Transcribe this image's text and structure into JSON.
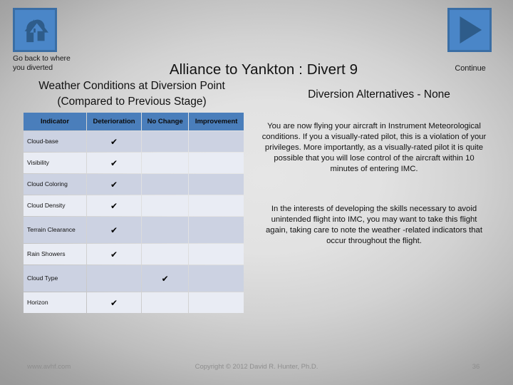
{
  "nav": {
    "back": {
      "icon": "u-turn-arrow-icon",
      "label": "Go back to where you diverted"
    },
    "continue": {
      "icon": "play-triangle-icon",
      "label": "Continue"
    }
  },
  "header": {
    "title": "Alliance to Yankton : Divert 9",
    "weather_heading": "Weather Conditions at Diversion Point",
    "weather_subheading": "(Compared to Previous Stage)",
    "alternatives_heading": "Diversion Alternatives - None"
  },
  "table": {
    "columns": [
      "Indicator",
      "Deterioration",
      "No Change",
      "Improvement"
    ],
    "check_glyph": "✔",
    "rows": [
      {
        "indicator": "Cloud-base",
        "deterioration": "✔",
        "no_change": "",
        "improvement": ""
      },
      {
        "indicator": "Visibility",
        "deterioration": "✔",
        "no_change": "",
        "improvement": ""
      },
      {
        "indicator": "Cloud Coloring",
        "deterioration": "✔",
        "no_change": "",
        "improvement": ""
      },
      {
        "indicator": "Cloud Density",
        "deterioration": "✔",
        "no_change": "",
        "improvement": ""
      },
      {
        "indicator": "Terrain Clearance",
        "deterioration": "✔",
        "no_change": "",
        "improvement": ""
      },
      {
        "indicator": "Rain Showers",
        "deterioration": "✔",
        "no_change": "",
        "improvement": ""
      },
      {
        "indicator": "Cloud Type",
        "deterioration": "",
        "no_change": "✔",
        "improvement": ""
      },
      {
        "indicator": "Horizon",
        "deterioration": "✔",
        "no_change": "",
        "improvement": ""
      }
    ]
  },
  "content": {
    "imc_paragraph": "You are now flying your aircraft in Instrument Meteorological conditions.  If you a visually-rated pilot, this is a violation of your privileges.  More importantly, as a visually-rated pilot it is quite possible that you will lose control of the aircraft within 10 minutes of entering IMC.",
    "practice_paragraph": "In the interests of developing the skills necessary to avoid unintended flight into IMC, you may want to take this flight again, taking care to note the weather -related indicators that occur throughout the flight."
  },
  "footer": {
    "url": "www.avhf.com",
    "copyright": "Copyright © 2012 David R. Hunter, Ph.D.",
    "page_number": "36"
  },
  "colors": {
    "button_fill": "#4a86c8",
    "button_border": "#3a6ea5",
    "icon_fill": "#2e5c8a",
    "table_header": "#4a7ebb",
    "row_dark": "#ccd2e2",
    "row_light": "#e9ecf4"
  }
}
